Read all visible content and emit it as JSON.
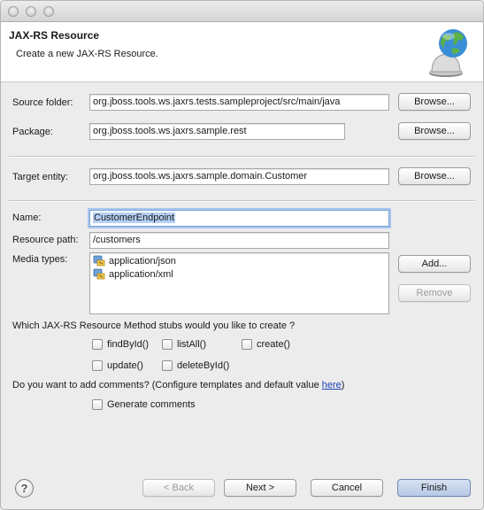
{
  "window": {
    "title": ""
  },
  "banner": {
    "title": "JAX-RS Resource",
    "description": "Create a new JAX-RS Resource.",
    "icon": "globe-bell-icon"
  },
  "form": {
    "source_folder": {
      "label": "Source folder:",
      "value": "org.jboss.tools.ws.jaxrs.tests.sampleproject/src/main/java",
      "browse_label": "Browse..."
    },
    "package": {
      "label": "Package:",
      "value": "org.jboss.tools.ws.jaxrs.sample.rest",
      "browse_label": "Browse..."
    },
    "target_entity": {
      "label": "Target entity:",
      "value": "org.jboss.tools.ws.jaxrs.sample.domain.Customer",
      "browse_label": "Browse..."
    },
    "name": {
      "label": "Name:",
      "value": "CustomerEndpoint"
    },
    "resource_path": {
      "label": "Resource path:",
      "value": "/customers"
    },
    "media_types": {
      "label": "Media types:",
      "items": [
        "application/json",
        "application/xml"
      ],
      "add_label": "Add...",
      "remove_label": "Remove"
    },
    "stubs": {
      "question": "Which JAX-RS Resource Method stubs would you like to create ?",
      "options": [
        {
          "label": "findById()",
          "checked": false
        },
        {
          "label": "listAll()",
          "checked": false
        },
        {
          "label": "create()",
          "checked": false
        },
        {
          "label": "update()",
          "checked": false
        },
        {
          "label": "deleteById()",
          "checked": false
        }
      ]
    },
    "comments": {
      "question": "Do you want to add comments? (Configure templates and default value ",
      "link": "here",
      "question_end": ")",
      "generate_label": "Generate comments",
      "checked": false
    }
  },
  "footer": {
    "help": "?",
    "back": "< Back",
    "next": "Next >",
    "cancel": "Cancel",
    "finish": "Finish"
  }
}
